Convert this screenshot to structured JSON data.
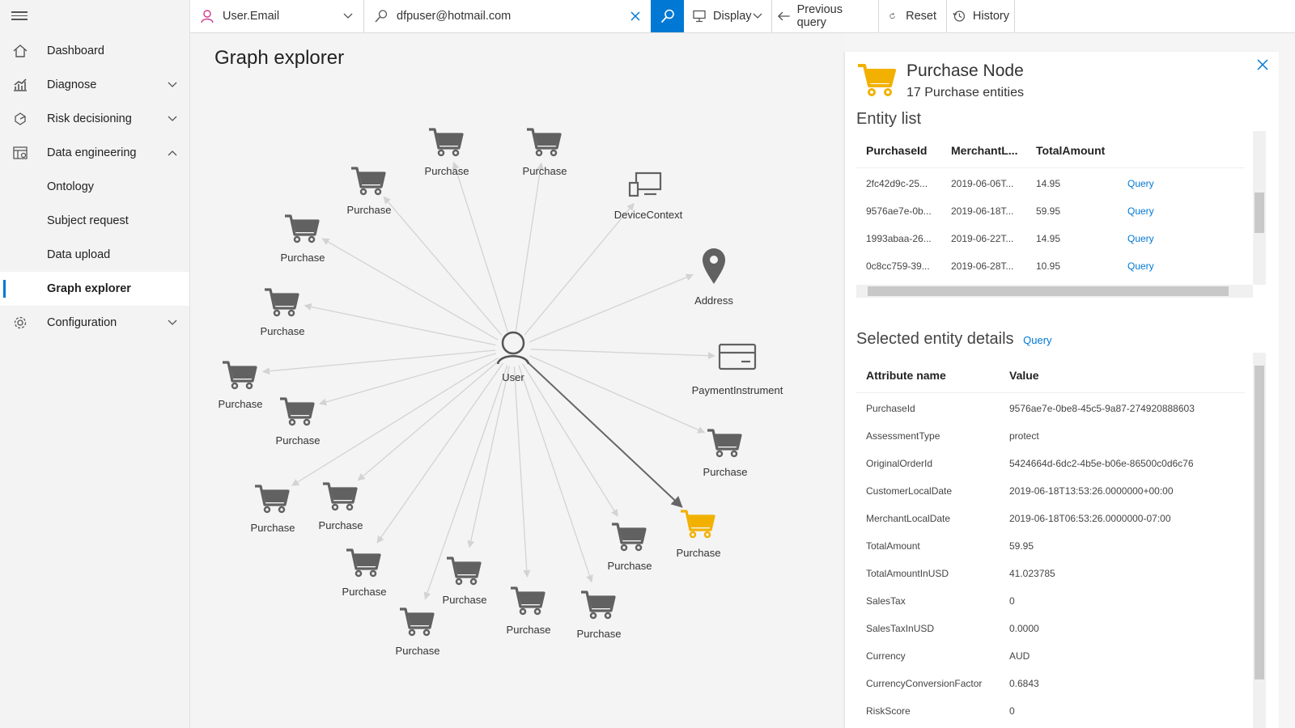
{
  "sidebar": {
    "items": [
      {
        "label": "Dashboard"
      },
      {
        "label": "Diagnose"
      },
      {
        "label": "Risk decisioning"
      },
      {
        "label": "Data engineering"
      },
      {
        "label": "Ontology"
      },
      {
        "label": "Subject request"
      },
      {
        "label": "Data upload"
      },
      {
        "label": "Graph explorer"
      },
      {
        "label": "Configuration"
      }
    ]
  },
  "toolbar": {
    "entity_select": "User.Email",
    "search_value": "dfpuser@hotmail.com",
    "display_label": "Display",
    "previous_query_label": "Previous query",
    "reset_label": "Reset",
    "history_label": "History"
  },
  "main": {
    "title": "Graph explorer"
  },
  "graph": {
    "center": {
      "label": "User"
    },
    "node_labels": {
      "purchase": "Purchase",
      "device": "DeviceContext",
      "address": "Address",
      "payment": "PaymentInstrument"
    },
    "colors": {
      "selected": "#f2b100",
      "icon": "#616161",
      "edge": "#d3d3d3",
      "edge_selected": "#666666"
    }
  },
  "panel": {
    "title": "Purchase Node",
    "subtitle": "17 Purchase entities",
    "entity_list_title": "Entity list",
    "entity_list_columns": [
      "PurchaseId",
      "MerchantL...",
      "TotalAmount"
    ],
    "entity_list_rows": [
      [
        "2fc42d9c-25...",
        "2019-06-06T...",
        "14.95",
        "Query"
      ],
      [
        "9576ae7e-0b...",
        "2019-06-18T...",
        "59.95",
        "Query"
      ],
      [
        "1993abaa-26...",
        "2019-06-22T...",
        "14.95",
        "Query"
      ],
      [
        "0c8cc759-39...",
        "2019-06-28T...",
        "10.95",
        "Query"
      ]
    ],
    "details_title": "Selected entity details",
    "details_link": "Query",
    "details_columns": [
      "Attribute name",
      "Value"
    ],
    "details_rows": [
      [
        "PurchaseId",
        "9576ae7e-0be8-45c5-9a87-274920888603"
      ],
      [
        "AssessmentType",
        "protect"
      ],
      [
        "OriginalOrderId",
        "5424664d-6dc2-4b5e-b06e-86500c0d6c76"
      ],
      [
        "CustomerLocalDate",
        "2019-06-18T13:53:26.0000000+00:00"
      ],
      [
        "MerchantLocalDate",
        "2019-06-18T06:53:26.0000000-07:00"
      ],
      [
        "TotalAmount",
        "59.95"
      ],
      [
        "TotalAmountInUSD",
        "41.023785"
      ],
      [
        "SalesTax",
        "0"
      ],
      [
        "SalesTaxInUSD",
        "0.0000"
      ],
      [
        "Currency",
        "AUD"
      ],
      [
        "CurrencyConversionFactor",
        "0.6843"
      ],
      [
        "RiskScore",
        "0"
      ]
    ]
  }
}
